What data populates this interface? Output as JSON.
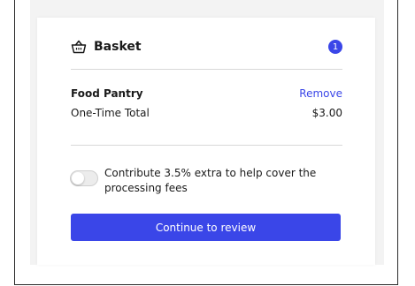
{
  "basket": {
    "icon": "basket-icon",
    "title": "Basket",
    "count": "1"
  },
  "items": [
    {
      "name": "Food Pantry",
      "remove_label": "Remove"
    }
  ],
  "summary": {
    "label": "One-Time Total",
    "value": "$3.00"
  },
  "fee_option": {
    "label": "Contribute 3.5% extra to help cover the processing fees",
    "enabled": false
  },
  "actions": {
    "continue_label": "Continue to review"
  },
  "colors": {
    "accent": "#3a46e8",
    "text": "#1a1a1a",
    "divider": "#d8d8d8",
    "panel_bg": "#f3f3f3"
  }
}
